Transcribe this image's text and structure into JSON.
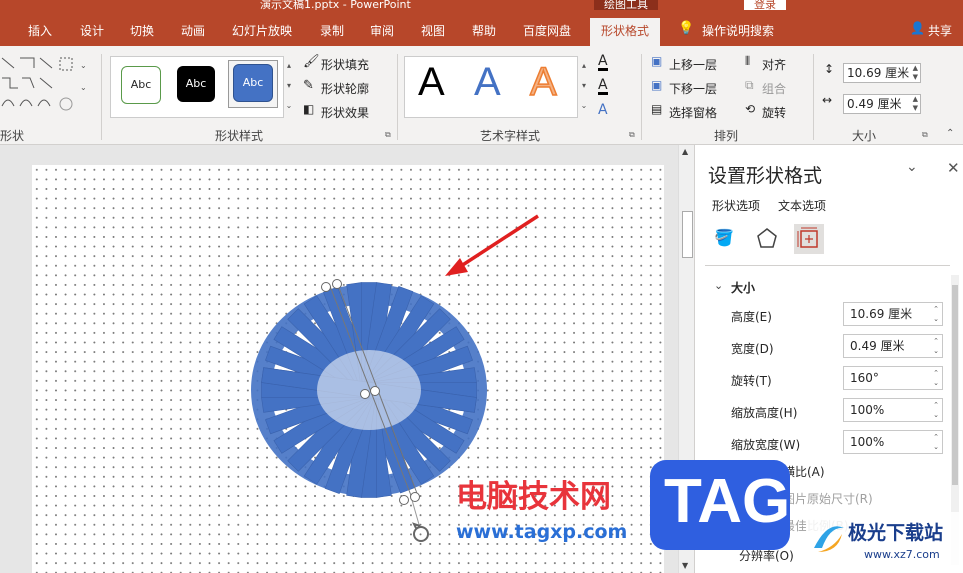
{
  "window": {
    "title": "演示文稿1.pptx - PowerPoint",
    "context_tab": "绘图工具",
    "login": "登录"
  },
  "tabs": [
    "插入",
    "设计",
    "切换",
    "动画",
    "幻灯片放映",
    "录制",
    "审阅",
    "视图",
    "帮助",
    "百度网盘",
    "形状格式"
  ],
  "tell_me": "操作说明搜索",
  "share": "共享",
  "ribbon": {
    "shapes_label": "形状",
    "shape_styles": {
      "label": "形状样式",
      "thumbs": [
        "Abc",
        "Abc",
        "Abc"
      ],
      "fill": "形状填充",
      "outline": "形状轮廓",
      "effects": "形状效果"
    },
    "wordart": {
      "label": "艺术字样式",
      "letters": [
        "A",
        "A",
        "A"
      ]
    },
    "arrange": {
      "label": "排列",
      "bring_forward": "上移一层",
      "send_backward": "下移一层",
      "selection_pane": "选择窗格",
      "align": "对齐",
      "group": "组合",
      "rotate": "旋转"
    },
    "size": {
      "label": "大小",
      "height": "10.69 厘米",
      "width": "0.49 厘米"
    }
  },
  "pane": {
    "title": "设置形状格式",
    "tabs": [
      "形状选项",
      "文本选项"
    ],
    "section": "大小",
    "fields": [
      {
        "label": "高度(E)",
        "value": "10.69 厘米"
      },
      {
        "label": "宽度(D)",
        "value": "0.49 厘米"
      },
      {
        "label": "旋转(T)",
        "value": "160°"
      },
      {
        "label": "缩放高度(H)",
        "value": "100%"
      },
      {
        "label": "缩放宽度(W)",
        "value": "100%"
      }
    ],
    "lock_ratio": "锁定纵横比(A)",
    "relative_original": "相对于图片原始尺寸(R)",
    "best_scale": "幻灯片最佳比例(B)",
    "resolution": "分辨率(O)"
  },
  "watermarks": {
    "site_name": "电脑技术网",
    "url": "www.tagxp.com",
    "tag": "TAG",
    "logo_text": "极光下载站",
    "logo_url": "www.xz7.com"
  },
  "colors": {
    "accent": "#b7472a",
    "shape": "#4472c4",
    "arrow": "#e02020"
  }
}
